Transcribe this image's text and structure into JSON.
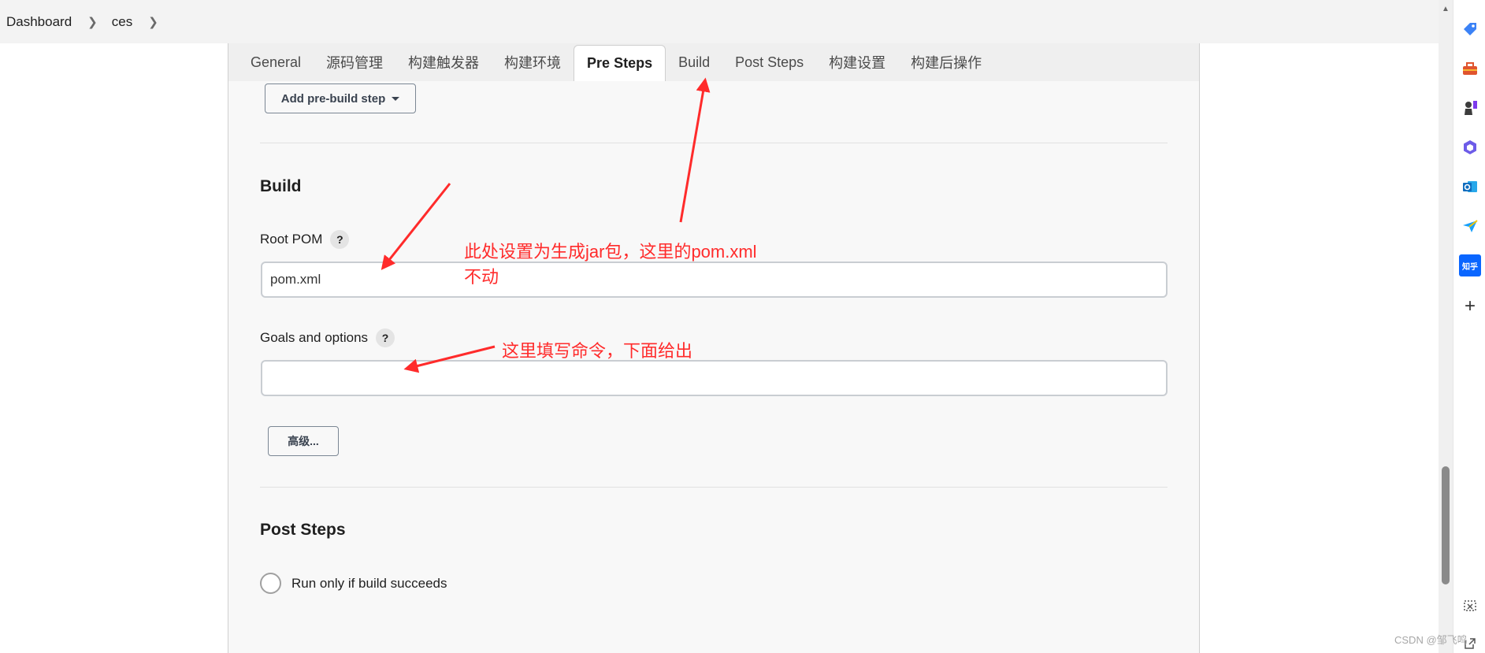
{
  "breadcrumb": {
    "items": [
      "Dashboard",
      "ces"
    ]
  },
  "tabs": [
    {
      "label": "General",
      "active": false
    },
    {
      "label": "源码管理",
      "active": false
    },
    {
      "label": "构建触发器",
      "active": false
    },
    {
      "label": "构建环境",
      "active": false
    },
    {
      "label": "Pre Steps",
      "active": true
    },
    {
      "label": "Build",
      "active": false
    },
    {
      "label": "Post Steps",
      "active": false
    },
    {
      "label": "构建设置",
      "active": false
    },
    {
      "label": "构建后操作",
      "active": false
    }
  ],
  "pre_steps": {
    "add_button": "Add pre-build step"
  },
  "build": {
    "title": "Build",
    "root_pom_label": "Root POM",
    "root_pom_value": "pom.xml",
    "goals_label": "Goals and options",
    "goals_value": "",
    "advanced_button": "高级..."
  },
  "post_steps": {
    "title": "Post Steps",
    "radio_label": "Run only if build succeeds"
  },
  "help_glyph": "?",
  "annotations": {
    "pom_line1": "此处设置为生成jar包，这里的pom.xml",
    "pom_line2": "不动",
    "goals": "这里填写命令，下面给出",
    "color": "#ff2b2b"
  },
  "side_rail": {
    "icons": [
      "tag-icon",
      "toolbox-icon",
      "chess-icon",
      "hexagon-icon",
      "outlook-icon",
      "send-icon",
      "zhihu-icon",
      "add-icon"
    ],
    "zhihu_label": "知乎",
    "add_glyph": "+"
  },
  "watermark": "CSDN @邹飞鸣"
}
